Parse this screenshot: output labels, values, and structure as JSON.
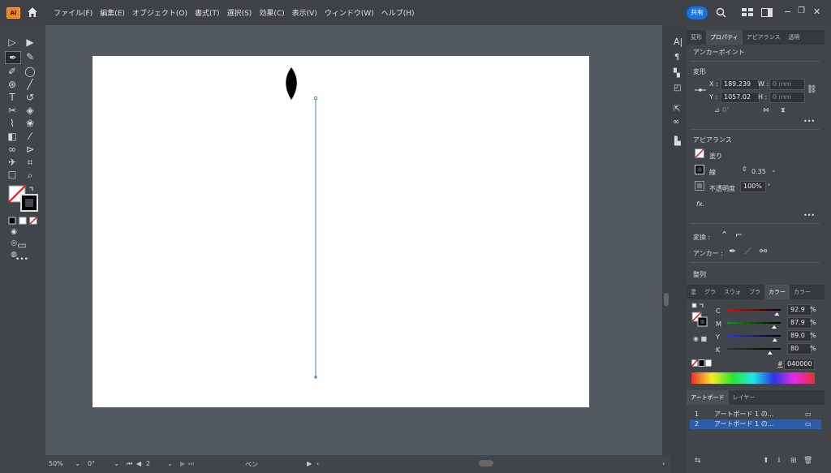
{
  "menubar": {
    "logo": "Ai",
    "items": [
      "ファイル(F)",
      "編集(E)",
      "オブジェクト(O)",
      "書式(T)",
      "選択(S)",
      "効果(C)",
      "表示(V)",
      "ウィンドウ(W)",
      "ヘルプ(H)"
    ],
    "share": "共有"
  },
  "status": {
    "zoom": "50%",
    "rotation": "0°",
    "artboard": "2",
    "tool": "ペン"
  },
  "panel": {
    "tabs": [
      "変形",
      "プロパティ",
      "アピアランス",
      "透明"
    ],
    "active_tab": "プロパティ",
    "anchor_title": "アンカーポイント",
    "transform_title": "変形",
    "x_label": "X :",
    "x_value": "189.239",
    "y_label": "Y :",
    "y_value": "1057.02",
    "w_label": "W :",
    "w_value": "0 mm",
    "h_label": "H :",
    "h_value": "0 mm",
    "angle_value": "0°",
    "appearance_title": "アピアランス",
    "fill_label": "塗り",
    "stroke_label": "線",
    "stroke_value": "0.35",
    "opacity_label": "不透明度",
    "opacity_value": "100%",
    "fx": "fx.",
    "convert_label": "変換 :",
    "anchor_label": "アンカー :",
    "align_label": "整列",
    "more": "•••"
  },
  "color_panel": {
    "tabs": [
      "塗",
      "グラ",
      "スウォ",
      "ブラ",
      "カラー",
      "カラー"
    ],
    "active_tab": "カラー",
    "channels": [
      {
        "name": "C",
        "value": "92.9",
        "fraction": 0.929
      },
      {
        "name": "M",
        "value": "87.9",
        "fraction": 0.879
      },
      {
        "name": "Y",
        "value": "89.0",
        "fraction": 0.89
      },
      {
        "name": "K",
        "value": "80",
        "fraction": 0.8
      }
    ],
    "pct": "%",
    "hex_label": "#",
    "hex": "040000"
  },
  "artboards_panel": {
    "tabs": [
      "アートボード",
      "レイヤー"
    ],
    "rows": [
      {
        "num": "1",
        "name": "アートボード 1 の..."
      },
      {
        "num": "2",
        "name": "アートボード 1 の..."
      }
    ]
  }
}
